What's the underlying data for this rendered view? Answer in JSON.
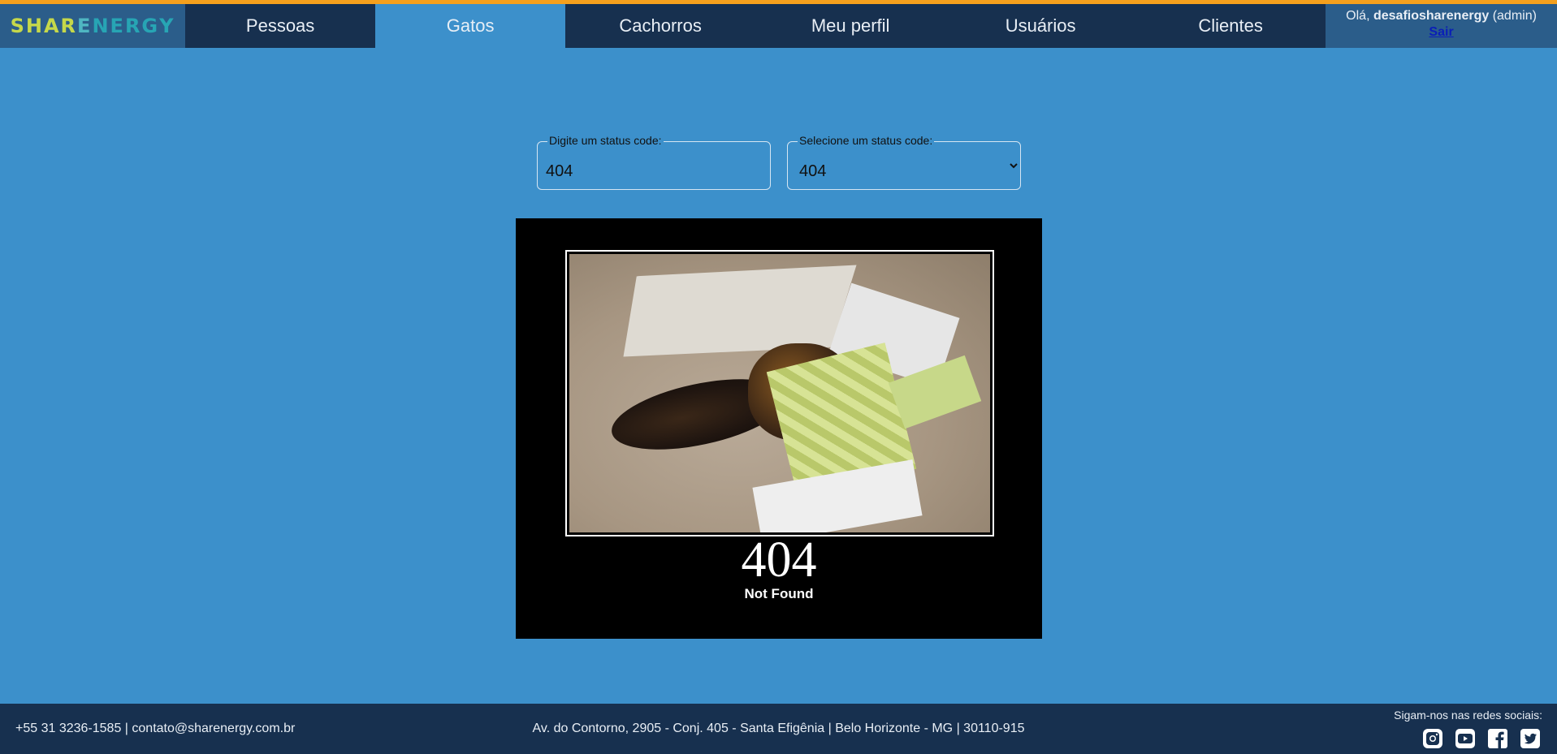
{
  "brand": {
    "logo_letters": [
      "S",
      "H",
      "A",
      "R",
      "E",
      "N",
      "E",
      "R",
      "G",
      "Y"
    ],
    "logo_colors": [
      "#c6d84a",
      "#c6d84a",
      "#c6d84a",
      "#c6d84a",
      "#4fb6c2",
      "#27a5b4",
      "#27a5b4",
      "#27a5b4",
      "#27a5b4",
      "#27a5b4"
    ],
    "accent_color": "#f5a01d",
    "header_color": "#17304f",
    "page_color": "#3c90cb"
  },
  "nav": {
    "items": [
      {
        "label": "Pessoas",
        "active": false
      },
      {
        "label": "Gatos",
        "active": true
      },
      {
        "label": "Cachorros",
        "active": false
      },
      {
        "label": "Meu perfil",
        "active": false
      },
      {
        "label": "Usuários",
        "active": false
      },
      {
        "label": "Clientes",
        "active": false
      }
    ]
  },
  "user": {
    "greeting": "Olá,",
    "username": "desafiosharenergy",
    "role": "(admin)",
    "logout_label": "Sair"
  },
  "form": {
    "input_label": "Digite um status code:",
    "input_value": "404",
    "select_label": "Selecione um status code:",
    "select_value": "404"
  },
  "result": {
    "code": "404",
    "text": "Not Found"
  },
  "footer": {
    "contact": "+55 31 3236-1585 | contato@sharenergy.com.br",
    "address": "Av. do Contorno, 2905 - Conj. 405 - Santa Efigênia | Belo Horizonte - MG | 30110-915",
    "social_title": "Sigam-nos nas redes sociais:",
    "social_icons": [
      "instagram-icon",
      "youtube-icon",
      "facebook-icon",
      "twitter-icon"
    ]
  }
}
